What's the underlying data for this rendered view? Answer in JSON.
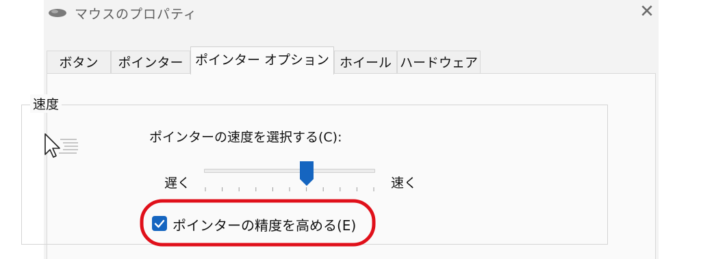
{
  "window": {
    "title": "マウスのプロパティ",
    "close_glyph": "✕"
  },
  "tabs": [
    {
      "label": "ボタン",
      "active": false
    },
    {
      "label": "ポインター",
      "active": false
    },
    {
      "label": "ポインター オプション",
      "active": true
    },
    {
      "label": "ホイール",
      "active": false
    },
    {
      "label": "ハードウェア",
      "active": false
    }
  ],
  "speed_group": {
    "label": "速度",
    "select_label": "ポインターの速度を選択する(C):",
    "slow_label": "遅く",
    "fast_label": "速く",
    "slider_value": 6,
    "slider_max": 10,
    "enhance_precision": {
      "label": "ポインターの精度を高める(E)",
      "checked": true
    }
  },
  "colors": {
    "accent": "#1565c0",
    "highlight_ring": "#e0101a"
  },
  "icons": {
    "title": "mouse-icon",
    "speed": "fast-pointer-icon",
    "close": "close-icon"
  }
}
